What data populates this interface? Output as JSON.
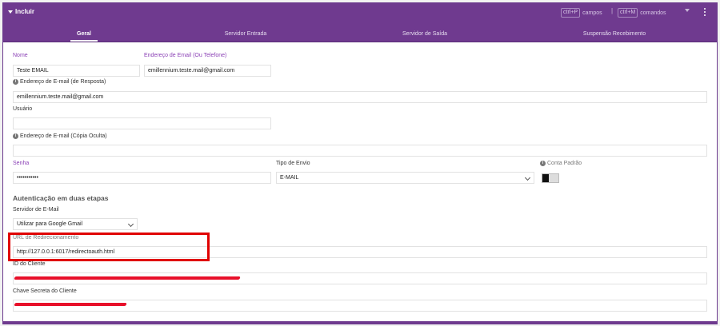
{
  "header": {
    "title": "Incluir",
    "shortcut_fields_key": "ctrl+P",
    "shortcut_fields_label": "campos",
    "separator": "|",
    "shortcut_commands_key": "ctrl+M",
    "shortcut_commands_label": "comandos"
  },
  "tabs": [
    {
      "label": "Geral"
    },
    {
      "label": "Servidor Entrada"
    },
    {
      "label": "Servidor de Saída"
    },
    {
      "label": "Suspensão Recebimento"
    }
  ],
  "form": {
    "nome_label": "Nome",
    "nome_value": "Teste EMAIL",
    "email_label": "Endereço de Email (Ou Telefone)",
    "email_value": "emillennium.teste.mail@gmail.com",
    "reply_label": "Endereço de E-mail (de Resposta)",
    "reply_value": "emillennium.teste.mail@gmail.com",
    "usuario_label": "Usuário",
    "usuario_value": "",
    "bcc_label": "Endereço de E-mail (Cópia Oculta)",
    "bcc_value": "",
    "senha_label": "Senha",
    "senha_value": "•••••••••••",
    "tipo_label": "Tipo de Envio",
    "tipo_value": "E-MAIL",
    "conta_label": "Conta Padrão",
    "two_step_title": "Autenticação em duas etapas",
    "servidor_label": "Servidor de E-Mail",
    "servidor_value": "Utilizar para Google Gmail",
    "url_label": "URL de Redirecionamento",
    "url_value": "http://127.0.0.1:6017/redirectoauth.html",
    "client_id_label": "ID do Cliente",
    "client_secret_label": "Chave Secreta do Cliente"
  },
  "colors": {
    "header_bg": "#6f3a8f",
    "accent_label": "#8a3fb5",
    "highlight": "#e00000",
    "redaction": "#e8102a"
  }
}
